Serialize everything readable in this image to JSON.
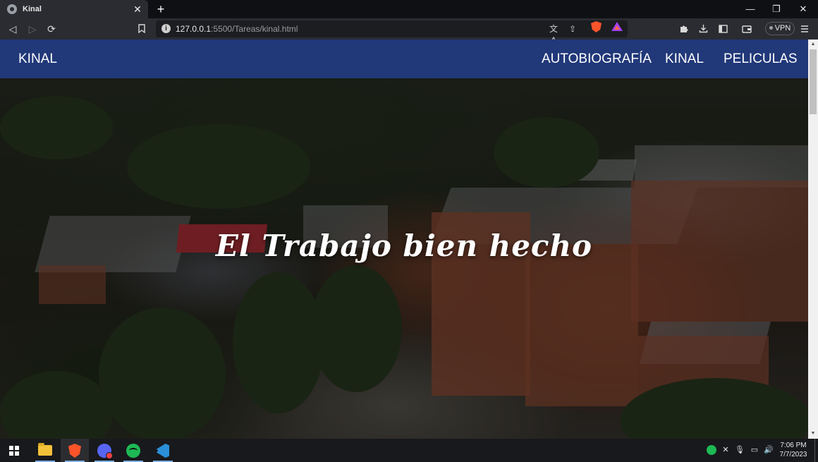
{
  "browser": {
    "tab": {
      "title": "Kinal",
      "favicon": "globe-icon",
      "close": "✕"
    },
    "new_tab": "+",
    "window_controls": {
      "minimize": "—",
      "restore": "❐",
      "close": "✕"
    },
    "toolbar": {
      "back": "◁",
      "forward": "▷",
      "reload": "⟳",
      "bookmark": "🔖"
    },
    "url": {
      "host": "127.0.0.1",
      "path": ":5500/Tareas/kinal.html",
      "info": "i"
    },
    "url_actions": {
      "translate": "文A",
      "share": "⇪"
    },
    "vpn_label": "VPN",
    "right_icons": [
      "puzzle-icon",
      "download-icon",
      "sidebar-icon",
      "wallet-icon",
      "menu-icon"
    ]
  },
  "page": {
    "nav": {
      "brand": "KINAL",
      "links": [
        "AUTOBIOGRAFÍA",
        "KINAL",
        "PELICULAS"
      ]
    },
    "hero": {
      "title": "El Trabajo bien hecho"
    }
  },
  "taskbar": {
    "apps": [
      "start",
      "file-explorer",
      "brave",
      "discord",
      "spotify",
      "vscode"
    ],
    "clock": {
      "time": "7:06 PM",
      "date": "7/7/2023"
    }
  },
  "colors": {
    "navbar": "#213879",
    "chrome_dark": "#0f1014",
    "chrome_toolbar": "#2b2c31",
    "taskbar": "#18191c"
  }
}
